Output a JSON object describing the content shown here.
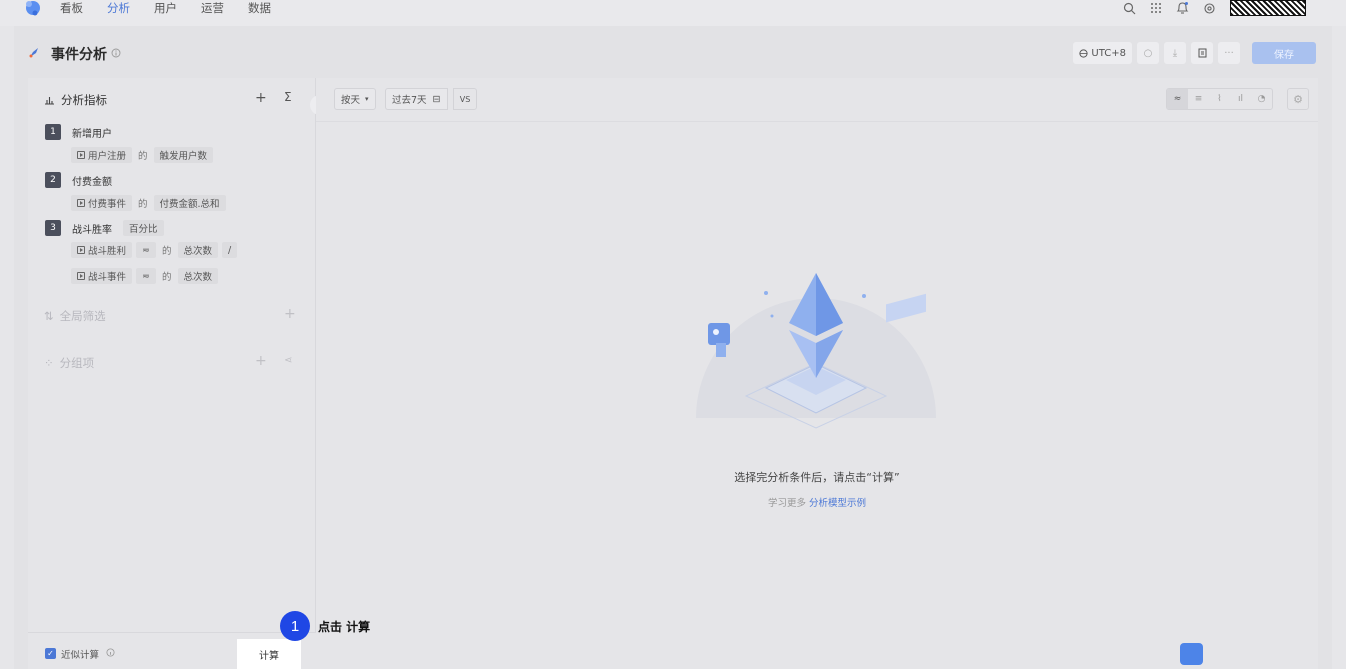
{
  "nav": {
    "items": [
      {
        "label": "看板",
        "active": false
      },
      {
        "label": "分析",
        "active": true
      },
      {
        "label": "用户",
        "active": false
      },
      {
        "label": "运营",
        "active": false
      },
      {
        "label": "数据",
        "active": false
      }
    ],
    "icons": [
      "search-icon",
      "apps-grid-icon",
      "bell-icon",
      "settings-icon"
    ]
  },
  "page": {
    "title": "事件分析",
    "timezone": "UTC+8",
    "save_label": "保存"
  },
  "metrics": {
    "header": "分析指标",
    "items": [
      {
        "index": "1",
        "name": "新增用户",
        "event": "用户注册",
        "de": "的",
        "measure": "触发用户数"
      },
      {
        "index": "2",
        "name": "付费金额",
        "event": "付费事件",
        "de": "的",
        "measure": "付费金额.总和"
      },
      {
        "index": "3",
        "name": "战斗胜率",
        "format": "百分比",
        "rows": [
          {
            "event": "战斗胜利",
            "de": "的",
            "measure": "总次数",
            "op": "/"
          },
          {
            "event": "战斗事件",
            "de": "的",
            "measure": "总次数"
          }
        ]
      }
    ]
  },
  "filters": {
    "header": "全局筛选"
  },
  "groups": {
    "header": "分组项"
  },
  "bottom": {
    "approx_label": "近似计算",
    "approx_checked": true,
    "calc_label": "计算",
    "collapse_label": "«"
  },
  "toolbar": {
    "granularity": "按天",
    "date_range": "过去7天",
    "vs_label": "VS"
  },
  "empty": {
    "message": "选择完分析条件后，请点击“计算”",
    "sub_prefix": "学习更多",
    "sub_link": "分析模型示例"
  },
  "annotation": {
    "step": "1",
    "text": "点击 计算"
  },
  "colors": {
    "accent": "#4c78d6",
    "annotation": "#1f47e5"
  }
}
